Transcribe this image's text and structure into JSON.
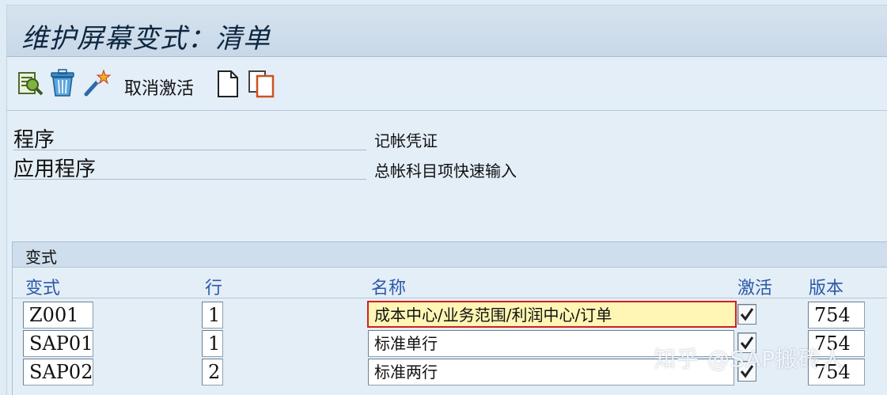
{
  "window": {
    "title": "维护屏幕变式：清单"
  },
  "toolbar": {
    "icons": [
      "display-details-icon",
      "delete-trash-icon",
      "magic-wand-icon",
      "new-document-icon",
      "copy-document-icon"
    ],
    "deactivate_label": "取消激活"
  },
  "header_fields": [
    {
      "label": "程序",
      "value": "记帐凭证"
    },
    {
      "label": "应用程序",
      "value": "总帐科目项快速输入"
    }
  ],
  "variants_group": {
    "title": "变式",
    "columns": [
      "变式",
      "行",
      "名称",
      "激活",
      "版本"
    ],
    "rows": [
      {
        "variant": "Z001",
        "row": "1",
        "name": "成本中心/业务范围/利润中心/订单",
        "active": true,
        "version": "754"
      },
      {
        "variant": "SAP01",
        "row": "1",
        "name": "标准单行",
        "active": true,
        "version": "754"
      },
      {
        "variant": "SAP02",
        "row": "2",
        "name": "标准两行",
        "active": true,
        "version": "754"
      }
    ]
  },
  "watermark": "知乎 @SAP搬砖人",
  "colors": {
    "title_bar": "#c8d8e8",
    "background": "#e4eef7",
    "column_header_text": "#2b5aa8",
    "highlight_fill": "#fff5b4",
    "highlight_border": "#d12020"
  }
}
